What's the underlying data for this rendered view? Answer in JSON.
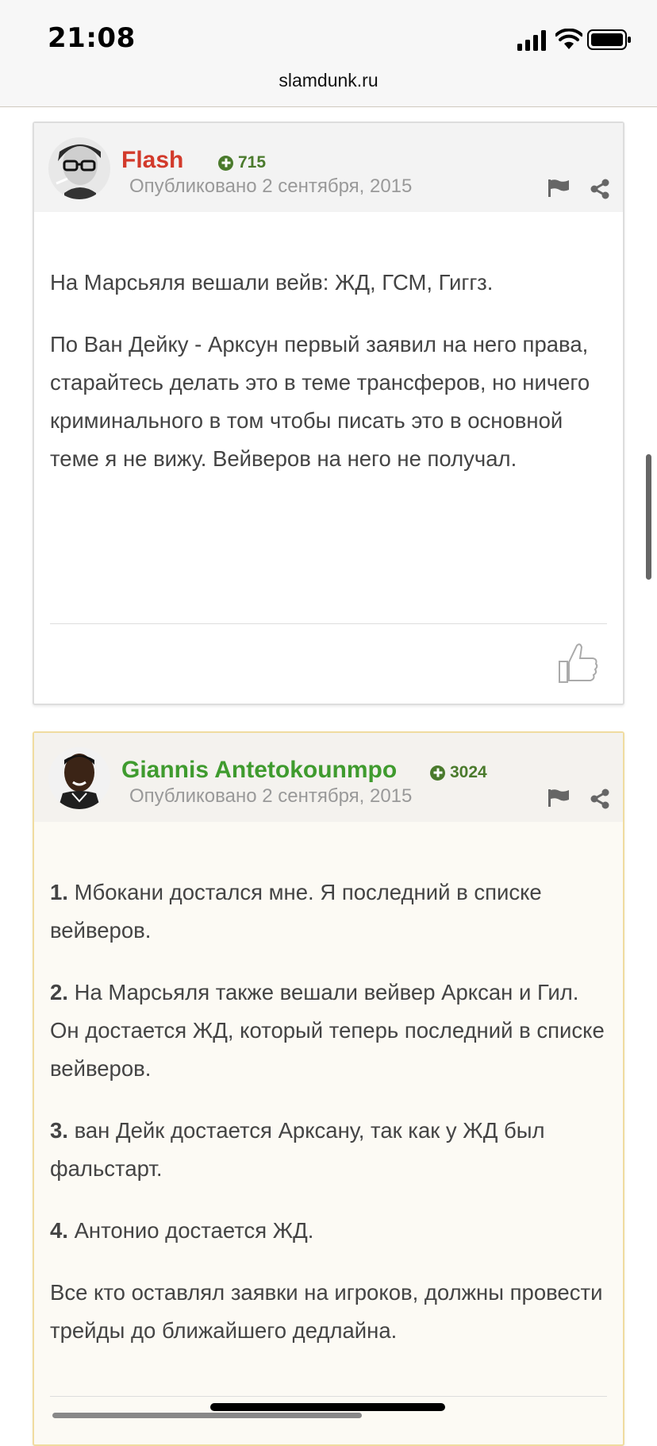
{
  "status_bar": {
    "time": "21:08"
  },
  "browser": {
    "url": "slamdunk.ru"
  },
  "posts": [
    {
      "author": "Flash",
      "author_color": "#d23a2b",
      "reputation": "715",
      "posted": "Опубликовано 2 сентября, 2015",
      "paragraphs": [
        "На Марсьяля вешали вейв: ЖД, ГСМ, Гиггз.",
        "По Ван Дейку - Арксун первый заявил на него права, старайтесь делать это в теме трансферов, но ничего криминального в том чтобы писать это в основной теме я не вижу. Вейверов на него не получал."
      ]
    },
    {
      "author": "Giannis Antetokounmpo",
      "author_color": "#3f9b2e",
      "reputation": "3024",
      "posted": "Опубликовано 2 сентября, 2015",
      "items": [
        {
          "num": "1.",
          "text": " Мбокани достался мне. Я последний в списке вейверов."
        },
        {
          "num": "2.",
          "text": " На Марсьяля также вешали вейвер Арксан и Гил. Он достается ЖД, который теперь последний в списке вейверов."
        },
        {
          "num": "3.",
          "text": " ван Дейк достается Арксану, так как у ЖД был фальстарт."
        },
        {
          "num": "4.",
          "text": " Антонио достается ЖД."
        }
      ],
      "closing": "Все кто оставлял заявки на игроков, должны провести трейды до ближайшего дедлайна."
    }
  ],
  "icons": {
    "flag": "flag-icon",
    "share": "share-icon",
    "like": "thumbs-up-icon",
    "reputation": "plus-circle-icon"
  }
}
